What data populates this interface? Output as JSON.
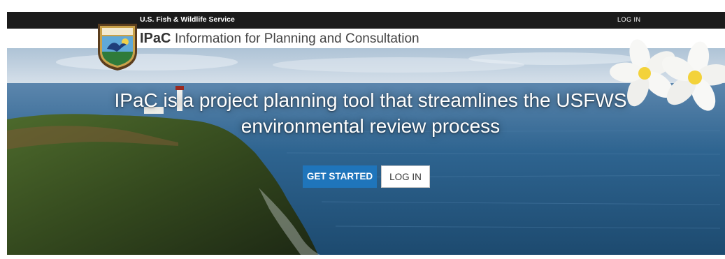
{
  "header": {
    "agency": "U.S. Fish & Wildlife Service",
    "login_label": "LOG IN",
    "logo_text": "U.S. FISH & WILDLIFE SERVICE"
  },
  "title": {
    "app_name": "IPaC",
    "app_description": "Information for Planning and Consultation"
  },
  "hero": {
    "headline_line1": "IPaC is a project planning tool that streamlines the USFWS",
    "headline_line2": "environmental review process",
    "get_started_label": "GET STARTED",
    "login_label": "LOG IN"
  },
  "colors": {
    "topbar": "#1b1b1b",
    "primary_button": "#1f75bb",
    "ocean": "#2c5f8a"
  }
}
